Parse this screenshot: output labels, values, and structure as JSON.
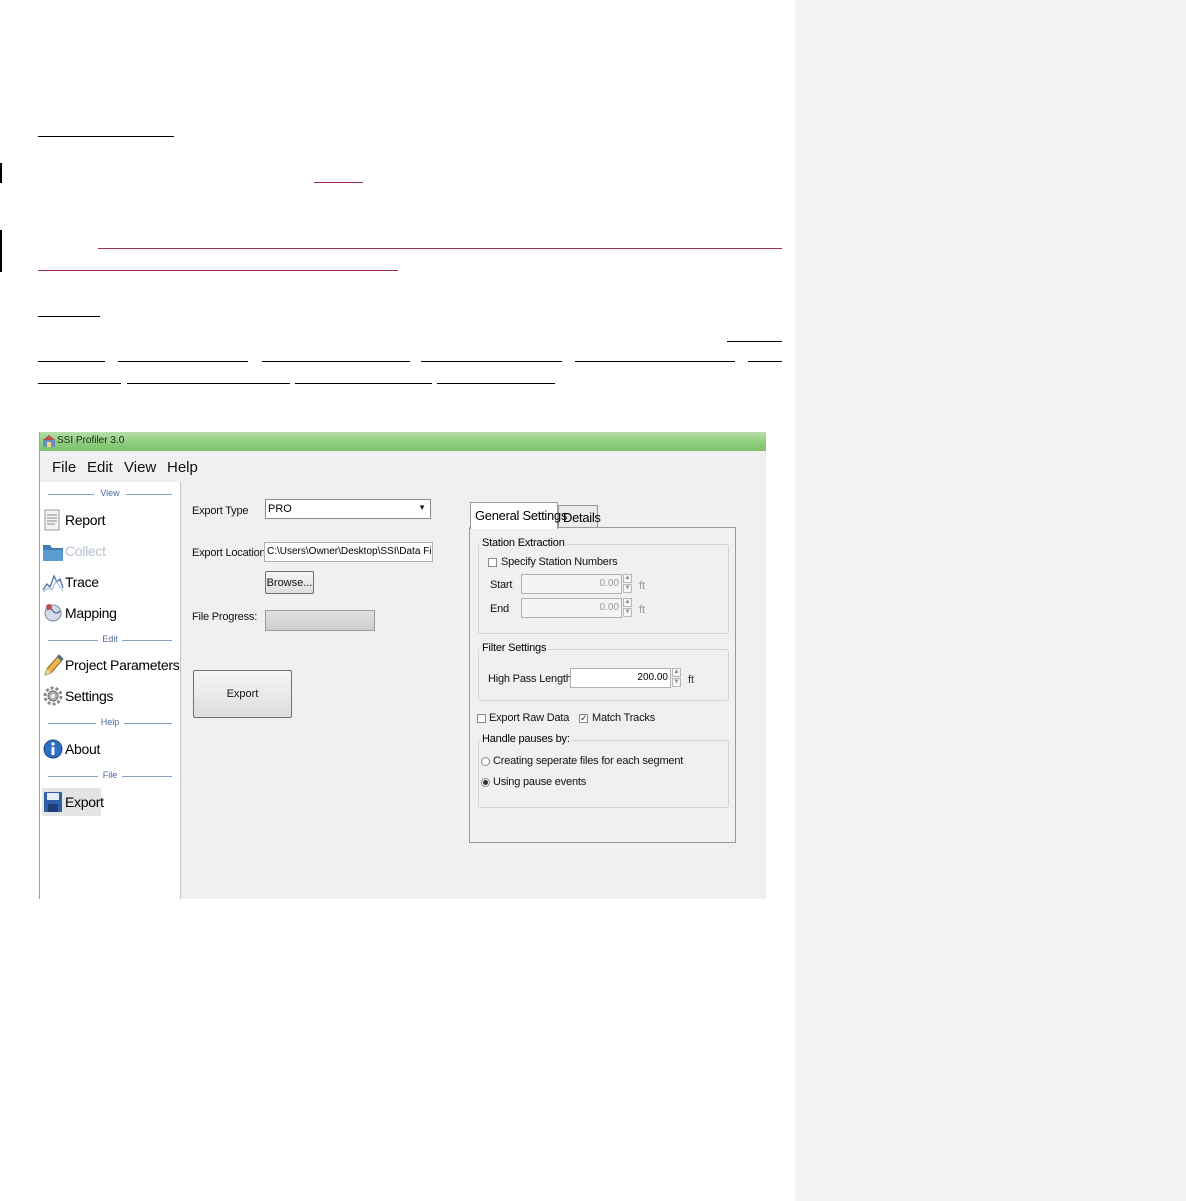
{
  "app": {
    "window_title": "SSI Profiler 3.0",
    "menu": [
      "File",
      "Edit",
      "View",
      "Help"
    ]
  },
  "sidebar": {
    "sections": {
      "view": "View",
      "edit": "Edit",
      "help": "Help",
      "file": "File"
    },
    "items": [
      {
        "label": "Report",
        "icon": "report-icon",
        "enabled": true
      },
      {
        "label": "Collect",
        "icon": "folder-icon",
        "enabled": false
      },
      {
        "label": "Trace",
        "icon": "trace-graph-icon",
        "enabled": true
      },
      {
        "label": "Mapping",
        "icon": "globe-icon",
        "enabled": true
      },
      {
        "label": "Project Parameters",
        "icon": "pencil-icon",
        "enabled": true
      },
      {
        "label": "Settings",
        "icon": "gear-icon",
        "enabled": true
      },
      {
        "label": "About",
        "icon": "info-icon",
        "enabled": true
      },
      {
        "label": "Export",
        "icon": "floppy-disk-icon",
        "enabled": true,
        "selected": true
      }
    ]
  },
  "export": {
    "type_label": "Export Type",
    "type_value": "PRO",
    "location_label": "Export Location",
    "location_value": "C:\\Users\\Owner\\Desktop\\SSI\\Data Files",
    "browse_label": "Browse...",
    "progress_label": "File Progress:",
    "progress_value": 0,
    "export_button": "Export"
  },
  "tabs": [
    {
      "label": "General Settings",
      "active": true
    },
    {
      "label": "Details",
      "active": false
    }
  ],
  "general": {
    "station_extraction": {
      "title": "Station Extraction",
      "specify_label": "Specify Station Numbers",
      "specify_checked": false,
      "start_label": "Start",
      "start_value": "0.00",
      "end_label": "End",
      "end_value": "0.00",
      "unit": "ft"
    },
    "filter_settings": {
      "title": "Filter Settings",
      "high_pass_label": "High Pass Length",
      "high_pass_value": "200.00",
      "unit": "ft"
    },
    "export_raw_label": "Export Raw Data",
    "export_raw_checked": false,
    "match_tracks_label": "Match Tracks",
    "match_tracks_checked": true,
    "pauses": {
      "title": "Handle pauses by:",
      "option_separate": "Creating seperate files for each segment",
      "option_events": "Using pause events",
      "selected": "option_events"
    }
  }
}
